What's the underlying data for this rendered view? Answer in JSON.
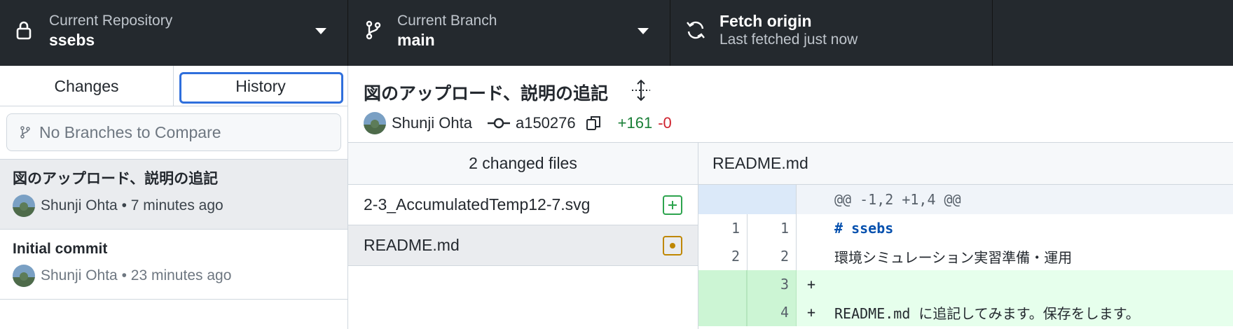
{
  "toolbar": {
    "repo": {
      "label": "Current Repository",
      "value": "ssebs",
      "icon": "lock-icon"
    },
    "branch": {
      "label": "Current Branch",
      "value": "main",
      "icon": "git-branch-icon"
    },
    "fetch": {
      "label": "Fetch origin",
      "value": "Last fetched just now",
      "icon": "sync-icon"
    }
  },
  "sidebar": {
    "tabs": [
      {
        "label": "Changes"
      },
      {
        "label": "History"
      }
    ],
    "compare_placeholder": "No Branches to Compare",
    "commits": [
      {
        "title": "図のアップロード、説明の追記",
        "author": "Shunji Ohta",
        "time": "7 minutes ago"
      },
      {
        "title": "Initial commit",
        "author": "Shunji Ohta",
        "time": "23 minutes ago"
      }
    ]
  },
  "commit": {
    "title": "図のアップロード、説明の追記",
    "author": "Shunji Ohta",
    "sha": "a150276",
    "additions": "+161",
    "deletions": "-0"
  },
  "files": {
    "header": "2 changed files",
    "items": [
      {
        "name": "2-3_AccumulatedTemp12-7.svg",
        "status": "added"
      },
      {
        "name": "README.md",
        "status": "modified"
      }
    ]
  },
  "diff": {
    "filename": "README.md",
    "hunk": "@@ -1,2 +1,4 @@",
    "lines": [
      {
        "old": "1",
        "new": "1",
        "sign": "",
        "text": "# ssebs",
        "type": "context"
      },
      {
        "old": "2",
        "new": "2",
        "sign": "",
        "text": "環境シミュレーション実習準備・運用",
        "type": "context"
      },
      {
        "old": "",
        "new": "3",
        "sign": "+",
        "text": "",
        "type": "add"
      },
      {
        "old": "",
        "new": "4",
        "sign": "+",
        "text": "README.md に追記してみます。保存をします。",
        "type": "add"
      }
    ]
  },
  "colors": {
    "toolbar_bg": "#24292e",
    "accent": "#2f6fdc",
    "added": "#1a7f37",
    "deleted": "#cf222e",
    "modified": "#bf8700"
  }
}
